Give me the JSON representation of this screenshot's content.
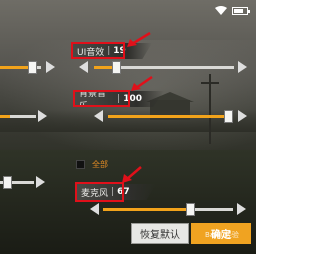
{
  "status_bar": {
    "wifi_icon": "wifi-icon",
    "battery_icon": "battery-icon"
  },
  "ui_volume": {
    "label": "UI音效",
    "value": "19",
    "level": 0.19
  },
  "bgm_volume": {
    "label": "背景音乐",
    "value": "100",
    "level": 1.0
  },
  "select_all": {
    "label": "全部"
  },
  "mic_volume": {
    "label": "麦克风",
    "value": "67",
    "level": 0.67
  },
  "buttons": {
    "restore": "恢复默认",
    "confirm": "确定"
  },
  "watermark": "Baidu经验",
  "colors": {
    "accent": "#f2a31b",
    "annotation_red": "#e0101a"
  }
}
